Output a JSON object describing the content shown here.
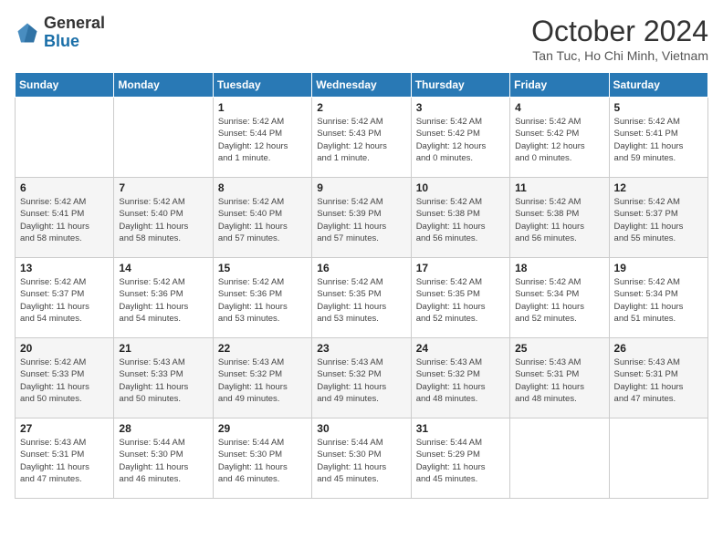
{
  "header": {
    "logo": {
      "general": "General",
      "blue": "Blue"
    },
    "title": "October 2024",
    "location": "Tan Tuc, Ho Chi Minh, Vietnam"
  },
  "days_header": [
    "Sunday",
    "Monday",
    "Tuesday",
    "Wednesday",
    "Thursday",
    "Friday",
    "Saturday"
  ],
  "weeks": [
    [
      {
        "day": "",
        "info": ""
      },
      {
        "day": "",
        "info": ""
      },
      {
        "day": "1",
        "info": "Sunrise: 5:42 AM\nSunset: 5:44 PM\nDaylight: 12 hours\nand 1 minute."
      },
      {
        "day": "2",
        "info": "Sunrise: 5:42 AM\nSunset: 5:43 PM\nDaylight: 12 hours\nand 1 minute."
      },
      {
        "day": "3",
        "info": "Sunrise: 5:42 AM\nSunset: 5:42 PM\nDaylight: 12 hours\nand 0 minutes."
      },
      {
        "day": "4",
        "info": "Sunrise: 5:42 AM\nSunset: 5:42 PM\nDaylight: 12 hours\nand 0 minutes."
      },
      {
        "day": "5",
        "info": "Sunrise: 5:42 AM\nSunset: 5:41 PM\nDaylight: 11 hours\nand 59 minutes."
      }
    ],
    [
      {
        "day": "6",
        "info": "Sunrise: 5:42 AM\nSunset: 5:41 PM\nDaylight: 11 hours\nand 58 minutes."
      },
      {
        "day": "7",
        "info": "Sunrise: 5:42 AM\nSunset: 5:40 PM\nDaylight: 11 hours\nand 58 minutes."
      },
      {
        "day": "8",
        "info": "Sunrise: 5:42 AM\nSunset: 5:40 PM\nDaylight: 11 hours\nand 57 minutes."
      },
      {
        "day": "9",
        "info": "Sunrise: 5:42 AM\nSunset: 5:39 PM\nDaylight: 11 hours\nand 57 minutes."
      },
      {
        "day": "10",
        "info": "Sunrise: 5:42 AM\nSunset: 5:38 PM\nDaylight: 11 hours\nand 56 minutes."
      },
      {
        "day": "11",
        "info": "Sunrise: 5:42 AM\nSunset: 5:38 PM\nDaylight: 11 hours\nand 56 minutes."
      },
      {
        "day": "12",
        "info": "Sunrise: 5:42 AM\nSunset: 5:37 PM\nDaylight: 11 hours\nand 55 minutes."
      }
    ],
    [
      {
        "day": "13",
        "info": "Sunrise: 5:42 AM\nSunset: 5:37 PM\nDaylight: 11 hours\nand 54 minutes."
      },
      {
        "day": "14",
        "info": "Sunrise: 5:42 AM\nSunset: 5:36 PM\nDaylight: 11 hours\nand 54 minutes."
      },
      {
        "day": "15",
        "info": "Sunrise: 5:42 AM\nSunset: 5:36 PM\nDaylight: 11 hours\nand 53 minutes."
      },
      {
        "day": "16",
        "info": "Sunrise: 5:42 AM\nSunset: 5:35 PM\nDaylight: 11 hours\nand 53 minutes."
      },
      {
        "day": "17",
        "info": "Sunrise: 5:42 AM\nSunset: 5:35 PM\nDaylight: 11 hours\nand 52 minutes."
      },
      {
        "day": "18",
        "info": "Sunrise: 5:42 AM\nSunset: 5:34 PM\nDaylight: 11 hours\nand 52 minutes."
      },
      {
        "day": "19",
        "info": "Sunrise: 5:42 AM\nSunset: 5:34 PM\nDaylight: 11 hours\nand 51 minutes."
      }
    ],
    [
      {
        "day": "20",
        "info": "Sunrise: 5:42 AM\nSunset: 5:33 PM\nDaylight: 11 hours\nand 50 minutes."
      },
      {
        "day": "21",
        "info": "Sunrise: 5:43 AM\nSunset: 5:33 PM\nDaylight: 11 hours\nand 50 minutes."
      },
      {
        "day": "22",
        "info": "Sunrise: 5:43 AM\nSunset: 5:32 PM\nDaylight: 11 hours\nand 49 minutes."
      },
      {
        "day": "23",
        "info": "Sunrise: 5:43 AM\nSunset: 5:32 PM\nDaylight: 11 hours\nand 49 minutes."
      },
      {
        "day": "24",
        "info": "Sunrise: 5:43 AM\nSunset: 5:32 PM\nDaylight: 11 hours\nand 48 minutes."
      },
      {
        "day": "25",
        "info": "Sunrise: 5:43 AM\nSunset: 5:31 PM\nDaylight: 11 hours\nand 48 minutes."
      },
      {
        "day": "26",
        "info": "Sunrise: 5:43 AM\nSunset: 5:31 PM\nDaylight: 11 hours\nand 47 minutes."
      }
    ],
    [
      {
        "day": "27",
        "info": "Sunrise: 5:43 AM\nSunset: 5:31 PM\nDaylight: 11 hours\nand 47 minutes."
      },
      {
        "day": "28",
        "info": "Sunrise: 5:44 AM\nSunset: 5:30 PM\nDaylight: 11 hours\nand 46 minutes."
      },
      {
        "day": "29",
        "info": "Sunrise: 5:44 AM\nSunset: 5:30 PM\nDaylight: 11 hours\nand 46 minutes."
      },
      {
        "day": "30",
        "info": "Sunrise: 5:44 AM\nSunset: 5:30 PM\nDaylight: 11 hours\nand 45 minutes."
      },
      {
        "day": "31",
        "info": "Sunrise: 5:44 AM\nSunset: 5:29 PM\nDaylight: 11 hours\nand 45 minutes."
      },
      {
        "day": "",
        "info": ""
      },
      {
        "day": "",
        "info": ""
      }
    ]
  ]
}
